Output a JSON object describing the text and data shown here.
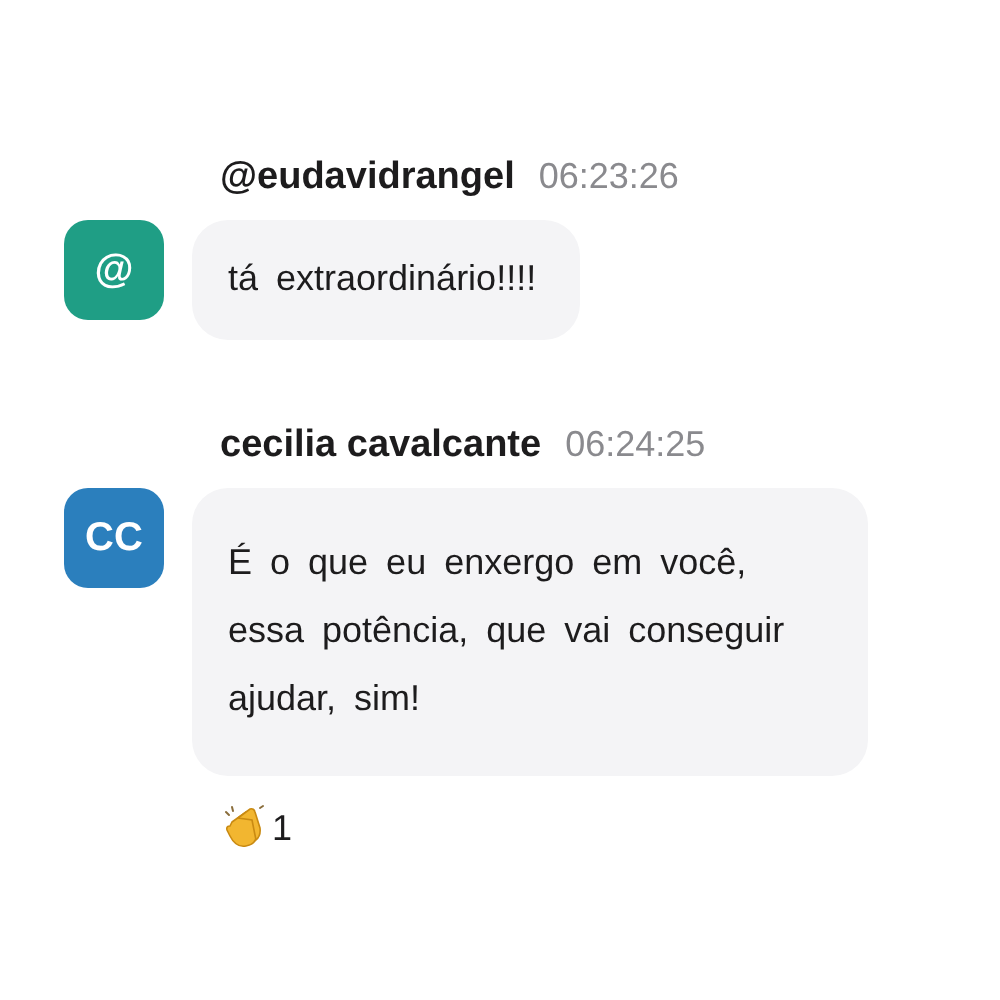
{
  "messages": [
    {
      "author": "@eudavidrangel",
      "time": "06:23:26",
      "avatar": {
        "initials": "@",
        "color": "#1f9e85"
      },
      "text": "tá extraordinário!!!!"
    },
    {
      "author": "cecilia cavalcante",
      "time": "06:24:25",
      "avatar": {
        "initials": "CC",
        "color": "#2b7fbd"
      },
      "text": "É o que eu enxergo em você, essa potência, que vai conseguir ajudar, sim!",
      "reactions": [
        {
          "kind": "clap",
          "count": "1"
        }
      ]
    }
  ]
}
